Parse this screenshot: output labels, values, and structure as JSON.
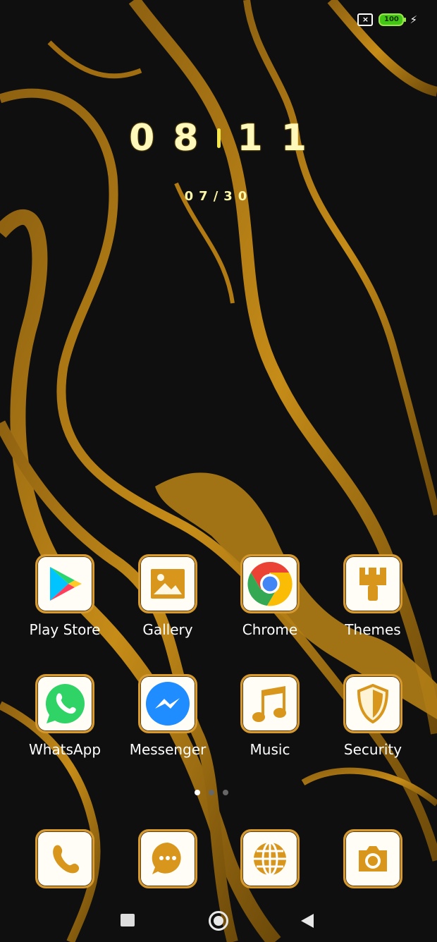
{
  "status": {
    "sim_status": "×",
    "battery": "100",
    "charging": "⚡"
  },
  "clock": {
    "hour": [
      "0",
      "8"
    ],
    "minute": [
      "1",
      "1"
    ],
    "date": "07/30"
  },
  "apps": [
    {
      "label": "Play Store",
      "icon": "play-store-icon"
    },
    {
      "label": "Gallery",
      "icon": "gallery-icon"
    },
    {
      "label": "Chrome",
      "icon": "chrome-icon"
    },
    {
      "label": "Themes",
      "icon": "themes-brush-icon"
    },
    {
      "label": "WhatsApp",
      "icon": "whatsapp-icon"
    },
    {
      "label": "Messenger",
      "icon": "messenger-icon"
    },
    {
      "label": "Music",
      "icon": "music-icon"
    },
    {
      "label": "Security",
      "icon": "security-shield-icon"
    }
  ],
  "dock": [
    {
      "icon": "phone-icon"
    },
    {
      "icon": "messages-icon"
    },
    {
      "icon": "browser-globe-icon"
    },
    {
      "icon": "camera-icon"
    }
  ],
  "page_indicator": {
    "total": 3,
    "active": 1
  },
  "colors": {
    "accent_gold": "#d79a2e",
    "wallpaper_dark": "#0d0d0d",
    "battery_green": "#43c716"
  }
}
